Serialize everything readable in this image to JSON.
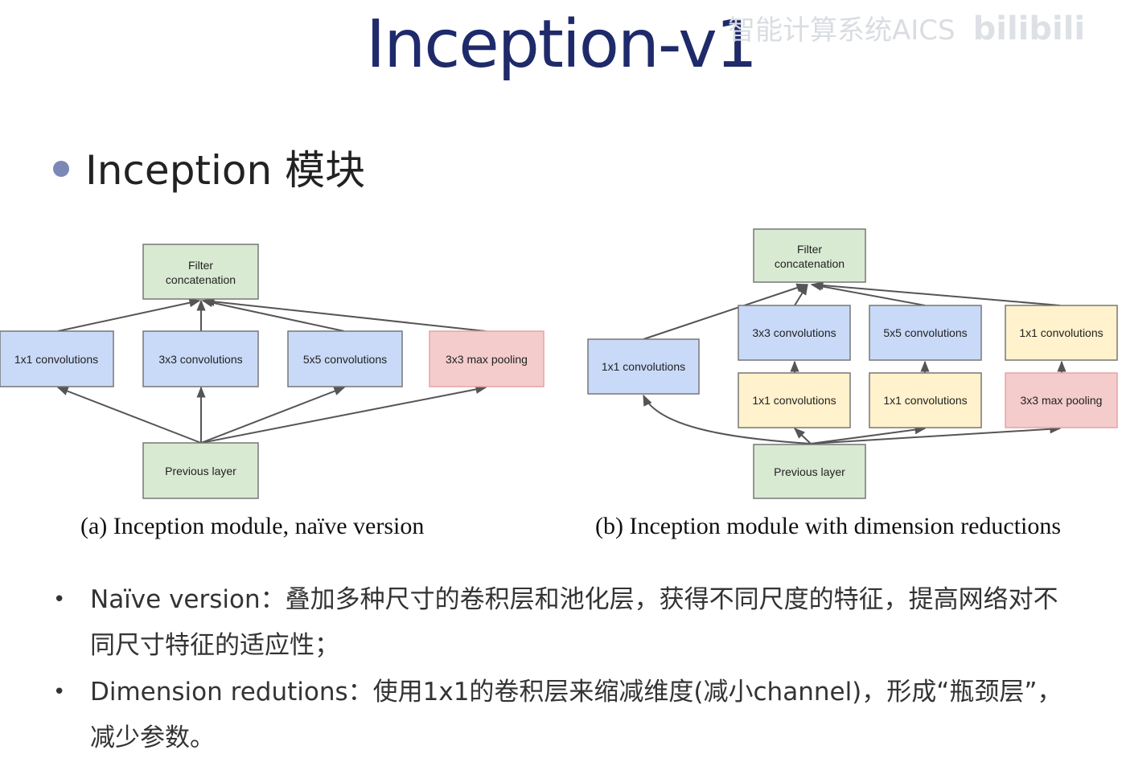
{
  "title": "Inception-v1",
  "watermark": {
    "text": "智能计算系统AICS",
    "logo": "bilibili"
  },
  "heading": "Inception 模块",
  "colors": {
    "green": "#d9ead3",
    "blue": "#c9daf8",
    "red": "#f4cccc",
    "yellow": "#fff2cc",
    "border": "#777777",
    "arrow": "#555555"
  },
  "diagram_a": {
    "top": "Filter\nconcatenation",
    "b1": "1x1 convolutions",
    "b2": "3x3 convolutions",
    "b3": "5x5 convolutions",
    "b4": "3x3 max pooling",
    "prev": "Previous layer",
    "caption": "(a)  Inception module, naïve version"
  },
  "diagram_b": {
    "top": "Filter\nconcatenation",
    "c1": "1x1 convolutions",
    "c2": "3x3 convolutions",
    "c3": "5x5 convolutions",
    "c4": "1x1 convolutions",
    "r2": "1x1 convolutions",
    "r3": "1x1 convolutions",
    "r4": "3x3 max pooling",
    "prev": "Previous layer",
    "caption": "(b)  Inception module with dimension reductions"
  },
  "bullets": [
    "Naïve version：叠加多种尺寸的卷积层和池化层，获得不同尺度的特征，提高网络对不同尺寸特征的适应性；",
    "Dimension redutions：使用1x1的卷积层来缩减维度(减小channel)，形成“瓶颈层”，减少参数。"
  ]
}
